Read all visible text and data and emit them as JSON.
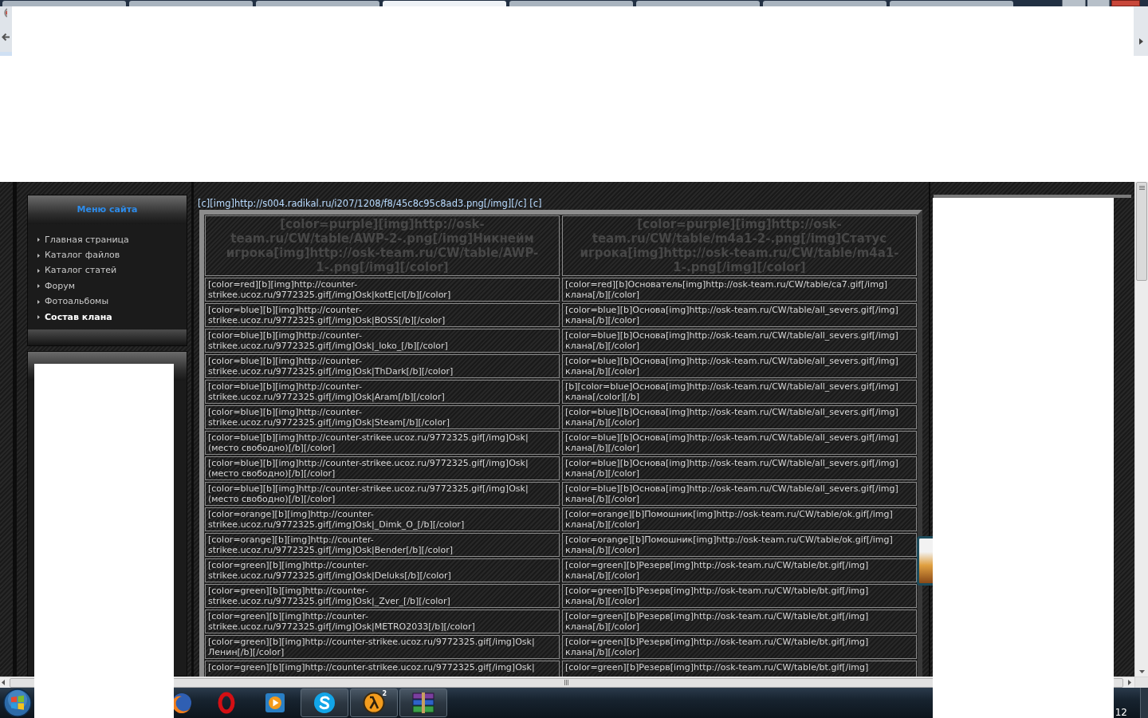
{
  "browser": {
    "tabs": [
      {
        "selected": false
      },
      {
        "selected": false
      },
      {
        "selected": false
      },
      {
        "selected": true
      },
      {
        "selected": false
      },
      {
        "selected": false
      },
      {
        "selected": false
      },
      {
        "selected": false
      }
    ]
  },
  "site_menu": {
    "title": "Меню сайта",
    "items": [
      {
        "label": "Главная страница",
        "selected": false
      },
      {
        "label": "Каталог файлов",
        "selected": false
      },
      {
        "label": "Каталог статей",
        "selected": false
      },
      {
        "label": "Форум",
        "selected": false
      },
      {
        "label": "Фотоальбомы",
        "selected": false
      },
      {
        "label": "Состав клана",
        "selected": true
      }
    ]
  },
  "content": {
    "top_line": "[c][img]http://s004.radikal.ru/i207/1208/f8/45c8c95c8ad3.png[/img][/c] [c]",
    "table": {
      "columns": [
        "[color=purple][img]http://osk-team.ru/CW/table/AWP-2-.png[/img]Никнейм игрока[img]http://osk-team.ru/CW/table/AWP-1-.png[/img][/color]",
        "[color=purple][img]http://osk-team.ru/CW/table/m4a1-2-.png[/img]Статус игрока[img]http://osk-team.ru/CW/table/m4a1-1-.png[/img][/color]"
      ],
      "rows": [
        [
          "[color=red][b][img]http://counter-strikee.ucoz.ru/9772325.gif[/img]Osk|kotE|cl[/b][/color]",
          "[color=red][b]Основатель[img]http://osk-team.ru/CW/table/ca7.gif[/img] клана[/b][/color]"
        ],
        [
          "[color=blue][b][img]http://counter-strikee.ucoz.ru/9772325.gif[/img]Osk|BOSS[/b][/color]",
          "[color=blue][b]Основа[img]http://osk-team.ru/CW/table/all_severs.gif[/img] клана[/b][/color]"
        ],
        [
          "[color=blue][b][img]http://counter-strikee.ucoz.ru/9772325.gif[/img]Osk|_loko_[/b][/color]",
          "[color=blue][b]Основа[img]http://osk-team.ru/CW/table/all_severs.gif[/img] клана[/b][/color]"
        ],
        [
          "[color=blue][b][img]http://counter-strikee.ucoz.ru/9772325.gif[/img]Osk|ThDark[/b][/color]",
          "[color=blue][b]Основа[img]http://osk-team.ru/CW/table/all_severs.gif[/img] клана[/b][/color]"
        ],
        [
          "[color=blue][b][img]http://counter-strikee.ucoz.ru/9772325.gif[/img]Osk|Aram[/b][/color]",
          "[b][color=blue]Основа[img]http://osk-team.ru/CW/table/all_severs.gif[/img] клана[/color][/b]"
        ],
        [
          "[color=blue][b][img]http://counter-strikee.ucoz.ru/9772325.gif[/img]Osk|Steam[/b][/color]",
          "[color=blue][b]Основа[img]http://osk-team.ru/CW/table/all_severs.gif[/img] клана[/b][/color]"
        ],
        [
          "[color=blue][b][img]http://counter-strikee.ucoz.ru/9772325.gif[/img]Osk|(место свободно)[/b][/color]",
          "[color=blue][b]Основа[img]http://osk-team.ru/CW/table/all_severs.gif[/img] клана[/b][/color]"
        ],
        [
          "[color=blue][b][img]http://counter-strikee.ucoz.ru/9772325.gif[/img]Osk|(место свободно)[/b][/color]",
          "[color=blue][b]Основа[img]http://osk-team.ru/CW/table/all_severs.gif[/img] клана[/b][/color]"
        ],
        [
          "[color=blue][b][img]http://counter-strikee.ucoz.ru/9772325.gif[/img]Osk|(место свободно)[/b][/color]",
          "[color=blue][b]Основа[img]http://osk-team.ru/CW/table/all_severs.gif[/img] клана[/b][/color]"
        ],
        [
          "[color=orange][b][img]http://counter-strikee.ucoz.ru/9772325.gif[/img]Osk|_Dimk_O_[/b][/color]",
          "[color=orange][b]Помошник[img]http://osk-team.ru/CW/table/ok.gif[/img] клана[/b][/color]"
        ],
        [
          "[color=orange][b][img]http://counter-strikee.ucoz.ru/9772325.gif[/img]Osk|Bender[/b][/color]",
          "[color=orange][b]Помошник[img]http://osk-team.ru/CW/table/ok.gif[/img] клана[/b][/color]"
        ],
        [
          "[color=green][b][img]http://counter-strikee.ucoz.ru/9772325.gif[/img]Osk|Deluks[/b][/color]",
          "[color=green][b]Резерв[img]http://osk-team.ru/CW/table/bt.gif[/img] клана[/b][/color]"
        ],
        [
          "[color=green][b][img]http://counter-strikee.ucoz.ru/9772325.gif[/img]Osk|_Zver_[/b][/color]",
          "[color=green][b]Резерв[img]http://osk-team.ru/CW/table/bt.gif[/img] клана[/b][/color]"
        ],
        [
          "[color=green][b][img]http://counter-strikee.ucoz.ru/9772325.gif[/img]Osk|METRO2033[/b][/color]",
          "[color=green][b]Резерв[img]http://osk-team.ru/CW/table/bt.gif[/img] клана[/b][/color]"
        ],
        [
          "[color=green][b][img]http://counter-strikee.ucoz.ru/9772325.gif[/img]Osk|Ленин[/b][/color]",
          "[color=green][b]Резерв[img]http://osk-team.ru/CW/table/bt.gif[/img] клана[/b][/color]"
        ],
        [
          "[color=green][b][img]http://counter-strikee.ucoz.ru/9772325.gif[/img]Osk|",
          "[color=green][b]Резерв[img]http://osk-team.ru/CW/table/bt.gif[/img]"
        ]
      ]
    }
  },
  "taskbar": {
    "apps": [
      {
        "kind": "firefox",
        "running": false
      },
      {
        "kind": "opera",
        "running": false
      },
      {
        "kind": "media",
        "running": false
      },
      {
        "kind": "skype",
        "running": true
      },
      {
        "kind": "halflife",
        "running": true,
        "badge": "2"
      },
      {
        "kind": "winrar",
        "running": true
      }
    ],
    "clock": "12"
  }
}
